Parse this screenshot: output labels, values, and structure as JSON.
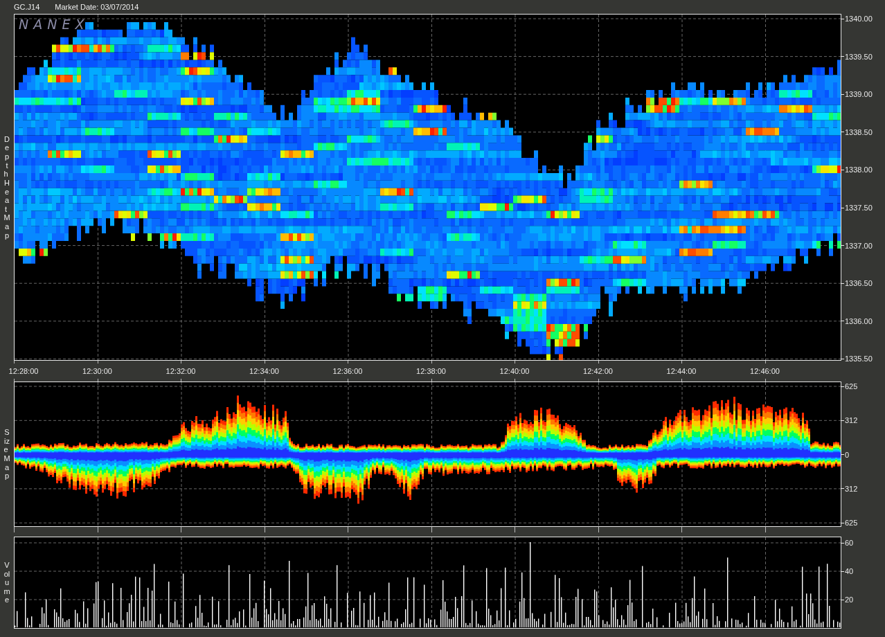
{
  "header": {
    "symbol": "GC.J14",
    "market_date": "Market Date: 03/07/2014"
  },
  "logo": "NANEX",
  "panels": [
    {
      "kind": "heatmap",
      "label": "Depth Heat Map",
      "y_ticks": [
        "1340.00",
        "1339.50",
        "1339.00",
        "1338.50",
        "1338.00",
        "1337.50",
        "1337.00",
        "1336.50",
        "1336.00",
        "1335.50"
      ]
    },
    {
      "kind": "sizemap",
      "label": "Size Map",
      "y_ticks": [
        "625",
        "312",
        "0",
        "312",
        "625"
      ]
    },
    {
      "kind": "volume",
      "label": "Volume",
      "y_ticks": [
        "60",
        "40",
        "20"
      ]
    }
  ],
  "time_axis": [
    "12:28:00",
    "12:30:00",
    "12:32:00",
    "12:34:00",
    "12:36:00",
    "12:38:00",
    "12:40:00",
    "12:42:00",
    "12:44:00",
    "12:46:00"
  ]
}
